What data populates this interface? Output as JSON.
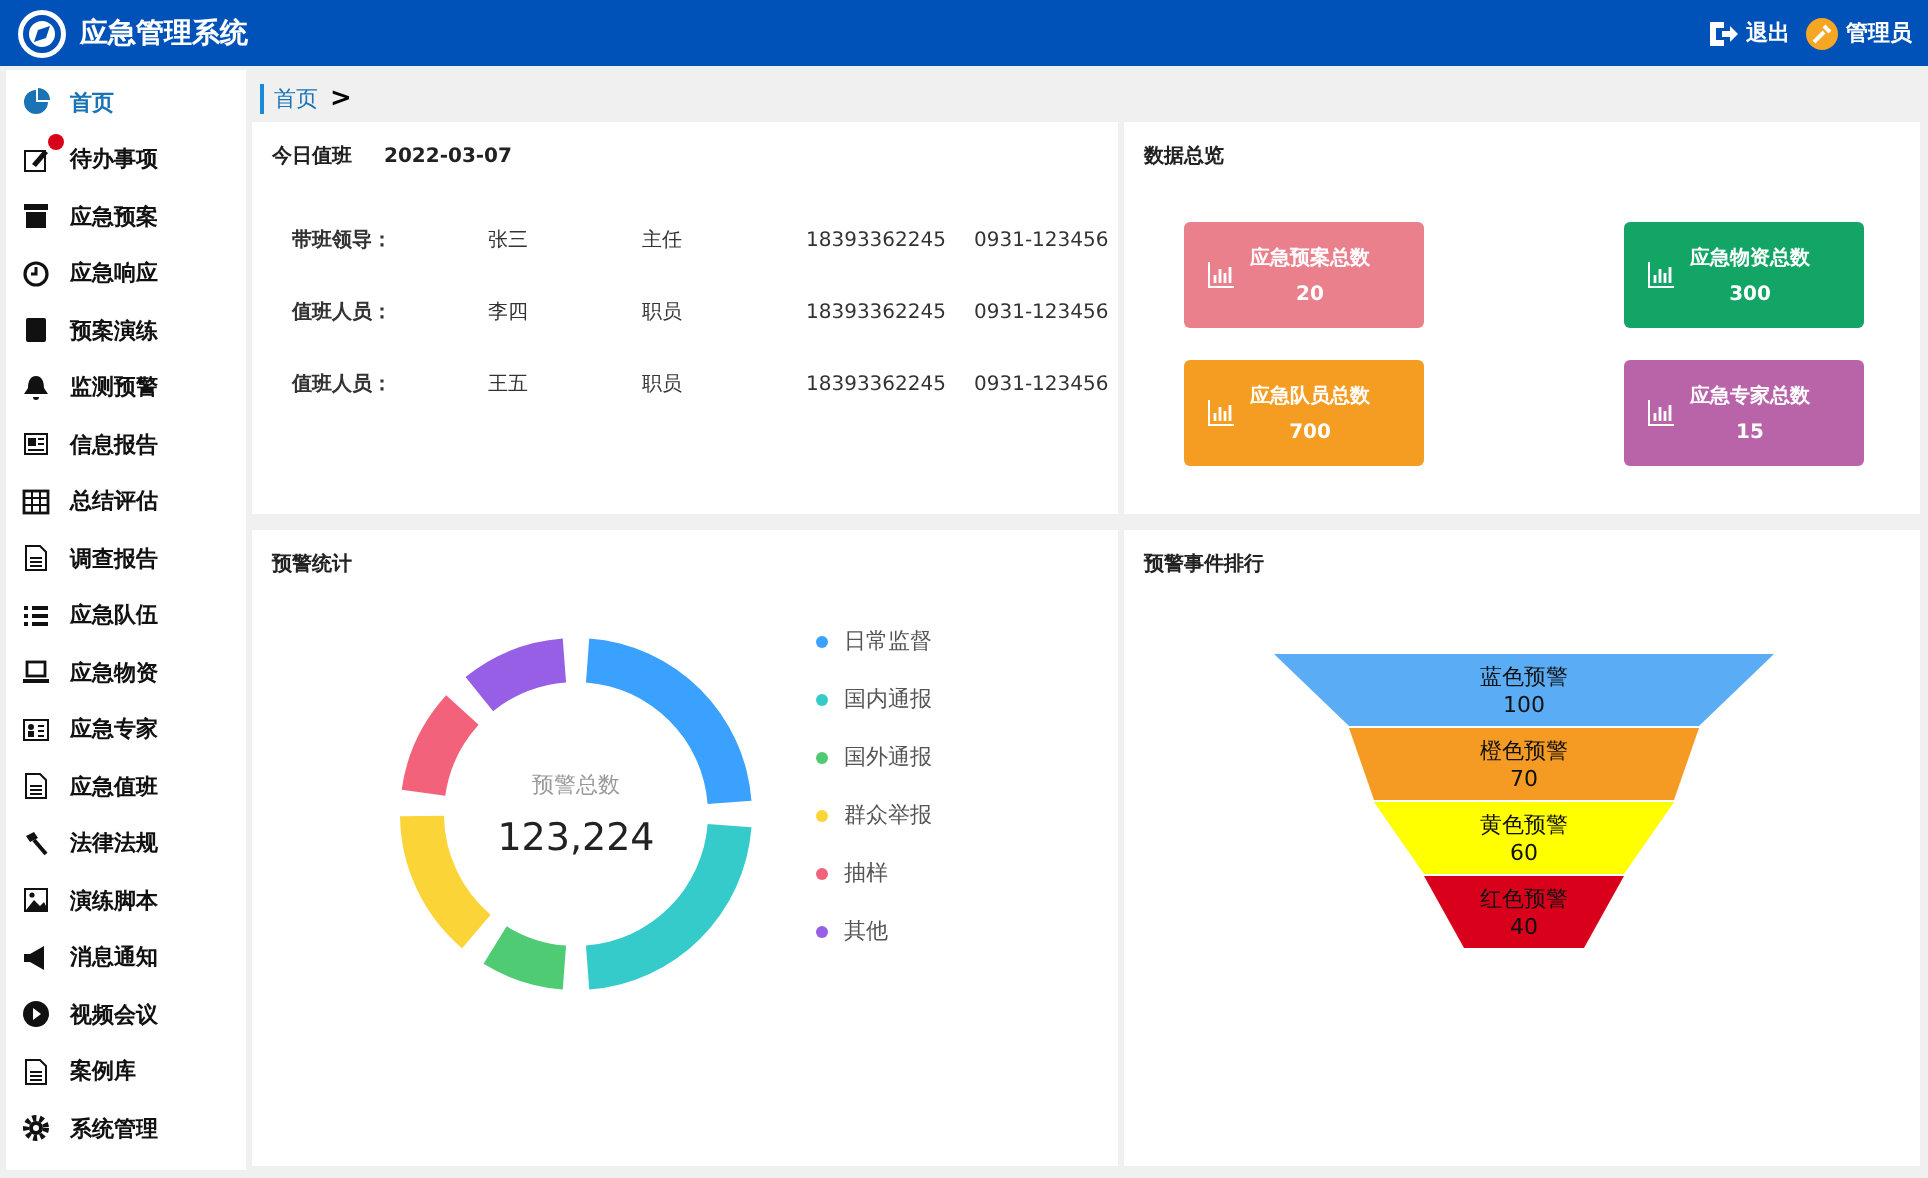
{
  "header": {
    "title": "应急管理系统",
    "logout": "退出",
    "user": "管理员"
  },
  "sidebar": {
    "items": [
      {
        "label": "首页",
        "selected": true,
        "badge": false
      },
      {
        "label": "待办事项",
        "selected": false,
        "badge": true
      },
      {
        "label": "应急预案",
        "selected": false,
        "badge": false
      },
      {
        "label": "应急响应",
        "selected": false,
        "badge": false
      },
      {
        "label": "预案演练",
        "selected": false,
        "badge": false
      },
      {
        "label": "监测预警",
        "selected": false,
        "badge": false
      },
      {
        "label": "信息报告",
        "selected": false,
        "badge": false
      },
      {
        "label": "总结评估",
        "selected": false,
        "badge": false
      },
      {
        "label": "调查报告",
        "selected": false,
        "badge": false
      },
      {
        "label": "应急队伍",
        "selected": false,
        "badge": false
      },
      {
        "label": "应急物资",
        "selected": false,
        "badge": false
      },
      {
        "label": "应急专家",
        "selected": false,
        "badge": false
      },
      {
        "label": "应急值班",
        "selected": false,
        "badge": false
      },
      {
        "label": "法律法规",
        "selected": false,
        "badge": false
      },
      {
        "label": "演练脚本",
        "selected": false,
        "badge": false
      },
      {
        "label": "消息通知",
        "selected": false,
        "badge": false
      },
      {
        "label": "视频会议",
        "selected": false,
        "badge": false
      },
      {
        "label": "案例库",
        "selected": false,
        "badge": false
      },
      {
        "label": "系统管理",
        "selected": false,
        "badge": false
      }
    ]
  },
  "breadcrumb": {
    "items": [
      "首页"
    ],
    "separator": ">"
  },
  "duty": {
    "title": "今日值班",
    "date": "2022-03-07",
    "rows": [
      {
        "role": "带班领导：",
        "name": "张三",
        "position": "主任",
        "mobile": "18393362245",
        "phone": "0931-123456"
      },
      {
        "role": "值班人员：",
        "name": "李四",
        "position": "职员",
        "mobile": "18393362245",
        "phone": "0931-123456"
      },
      {
        "role": "值班人员：",
        "name": "王五",
        "position": "职员",
        "mobile": "18393362245",
        "phone": "0931-123456"
      }
    ]
  },
  "overview": {
    "title": "数据总览",
    "cards": [
      {
        "label": "应急预案总数",
        "value": "20",
        "color": "#eb808d"
      },
      {
        "label": "应急物资总数",
        "value": "300",
        "color": "#13a565"
      },
      {
        "label": "应急队员总数",
        "value": "700",
        "color": "#f59c23"
      },
      {
        "label": "应急专家总数",
        "value": "15",
        "color": "#b964a9"
      }
    ]
  },
  "warning_stats": {
    "title": "预警统计",
    "center_label": "预警总数",
    "center_value": "123,224",
    "legend": [
      {
        "label": "日常监督",
        "color": "#3ba1ff"
      },
      {
        "label": "国内通报",
        "color": "#36cbcb"
      },
      {
        "label": "国外通报",
        "color": "#4ecb73"
      },
      {
        "label": "群众举报",
        "color": "#fbd437"
      },
      {
        "label": "抽样",
        "color": "#f2637b"
      },
      {
        "label": "其他",
        "color": "#975fe5"
      }
    ]
  },
  "ranking": {
    "title": "预警事件排行",
    "items": [
      {
        "label": "蓝色预警",
        "value": "100",
        "color": "#5aacf5"
      },
      {
        "label": "橙色预警",
        "value": "70",
        "color": "#f59a23"
      },
      {
        "label": "黄色预警",
        "value": "60",
        "color": "#ffff00"
      },
      {
        "label": "红色预警",
        "value": "40",
        "color": "#d9001b"
      }
    ]
  }
}
